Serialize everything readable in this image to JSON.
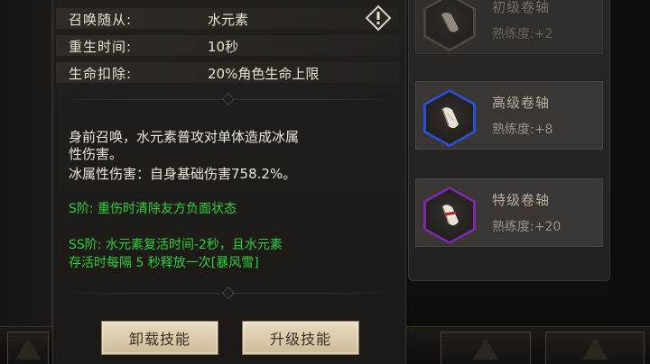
{
  "stats": [
    {
      "label": "召唤随从:",
      "value": "水元素"
    },
    {
      "label": "重生时间:",
      "value": "10秒"
    },
    {
      "label": "生命扣除:",
      "value": "20%角色生命上限"
    }
  ],
  "description": {
    "line1": "身前召唤，水元素普攻对单体造成冰属",
    "line2": "性伤害。",
    "line3": "冰属性伤害：自身基础伤害758.2%。"
  },
  "upgrades": {
    "s_tier": "S阶: 重伤时清除友方负面状态",
    "ss_tier_line1": "SS阶: 水元素复活时间-2秒，且水元素",
    "ss_tier_line2": "存活时每隔 5 秒释放一次[暴风雪]"
  },
  "buttons": {
    "unload": "卸载技能",
    "upgrade": "升级技能"
  },
  "scrolls": [
    {
      "title": "初级卷轴",
      "proficiency": "熟练度:+2",
      "ring_color": "#6b6258"
    },
    {
      "title": "高级卷轴",
      "proficiency": "熟练度:+8",
      "ring_color": "#2a4fd8"
    },
    {
      "title": "特级卷轴",
      "proficiency": "熟练度:+20",
      "ring_color": "#7a2aa8"
    }
  ],
  "colors": {
    "tier_text": "#2fd13a",
    "button_bg": "#e0d0b0"
  }
}
